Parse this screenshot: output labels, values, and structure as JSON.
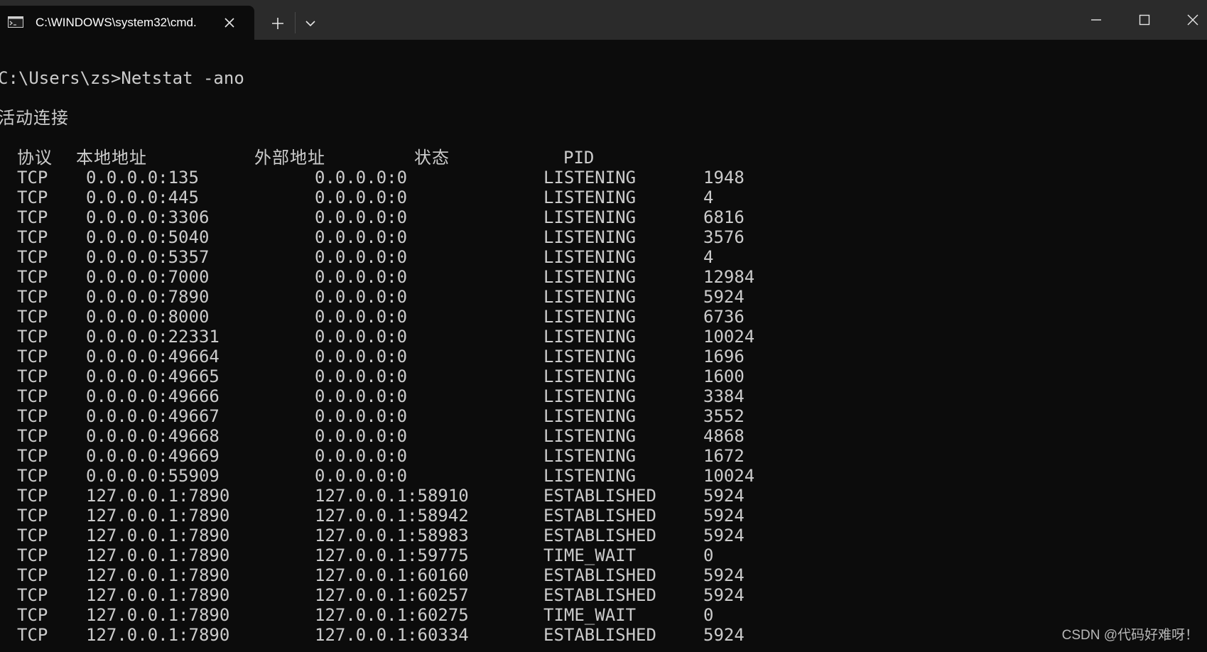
{
  "window": {
    "tab_title": "C:\\WINDOWS\\system32\\cmd.",
    "icons": {
      "tab": "terminal-icon",
      "close": "close-icon",
      "new_tab": "plus-icon",
      "dropdown": "chevron-down-icon",
      "minimize": "minimize-icon",
      "maximize": "maximize-icon",
      "window_close": "close-icon"
    },
    "colors": {
      "titlebar": "#2b2b2b",
      "background": "#0c0c0c",
      "text": "#cccccc"
    }
  },
  "console": {
    "prompt": "C:\\Users\\zs>Netstat -ano",
    "heading": "活动连接",
    "headers": {
      "proto": "协议",
      "local": "本地地址",
      "foreign": "外部地址",
      "state": "状态",
      "pid": "PID"
    },
    "rows": [
      {
        "proto": "TCP",
        "local": "0.0.0.0:135",
        "foreign": "0.0.0.0:0",
        "state": "LISTENING",
        "pid": "1948"
      },
      {
        "proto": "TCP",
        "local": "0.0.0.0:445",
        "foreign": "0.0.0.0:0",
        "state": "LISTENING",
        "pid": "4"
      },
      {
        "proto": "TCP",
        "local": "0.0.0.0:3306",
        "foreign": "0.0.0.0:0",
        "state": "LISTENING",
        "pid": "6816"
      },
      {
        "proto": "TCP",
        "local": "0.0.0.0:5040",
        "foreign": "0.0.0.0:0",
        "state": "LISTENING",
        "pid": "3576"
      },
      {
        "proto": "TCP",
        "local": "0.0.0.0:5357",
        "foreign": "0.0.0.0:0",
        "state": "LISTENING",
        "pid": "4"
      },
      {
        "proto": "TCP",
        "local": "0.0.0.0:7000",
        "foreign": "0.0.0.0:0",
        "state": "LISTENING",
        "pid": "12984"
      },
      {
        "proto": "TCP",
        "local": "0.0.0.0:7890",
        "foreign": "0.0.0.0:0",
        "state": "LISTENING",
        "pid": "5924"
      },
      {
        "proto": "TCP",
        "local": "0.0.0.0:8000",
        "foreign": "0.0.0.0:0",
        "state": "LISTENING",
        "pid": "6736"
      },
      {
        "proto": "TCP",
        "local": "0.0.0.0:22331",
        "foreign": "0.0.0.0:0",
        "state": "LISTENING",
        "pid": "10024"
      },
      {
        "proto": "TCP",
        "local": "0.0.0.0:49664",
        "foreign": "0.0.0.0:0",
        "state": "LISTENING",
        "pid": "1696"
      },
      {
        "proto": "TCP",
        "local": "0.0.0.0:49665",
        "foreign": "0.0.0.0:0",
        "state": "LISTENING",
        "pid": "1600"
      },
      {
        "proto": "TCP",
        "local": "0.0.0.0:49666",
        "foreign": "0.0.0.0:0",
        "state": "LISTENING",
        "pid": "3384"
      },
      {
        "proto": "TCP",
        "local": "0.0.0.0:49667",
        "foreign": "0.0.0.0:0",
        "state": "LISTENING",
        "pid": "3552"
      },
      {
        "proto": "TCP",
        "local": "0.0.0.0:49668",
        "foreign": "0.0.0.0:0",
        "state": "LISTENING",
        "pid": "4868"
      },
      {
        "proto": "TCP",
        "local": "0.0.0.0:49669",
        "foreign": "0.0.0.0:0",
        "state": "LISTENING",
        "pid": "1672"
      },
      {
        "proto": "TCP",
        "local": "0.0.0.0:55909",
        "foreign": "0.0.0.0:0",
        "state": "LISTENING",
        "pid": "10024"
      },
      {
        "proto": "TCP",
        "local": "127.0.0.1:7890",
        "foreign": "127.0.0.1:58910",
        "state": "ESTABLISHED",
        "pid": "5924"
      },
      {
        "proto": "TCP",
        "local": "127.0.0.1:7890",
        "foreign": "127.0.0.1:58942",
        "state": "ESTABLISHED",
        "pid": "5924"
      },
      {
        "proto": "TCP",
        "local": "127.0.0.1:7890",
        "foreign": "127.0.0.1:58983",
        "state": "ESTABLISHED",
        "pid": "5924"
      },
      {
        "proto": "TCP",
        "local": "127.0.0.1:7890",
        "foreign": "127.0.0.1:59775",
        "state": "TIME_WAIT",
        "pid": "0"
      },
      {
        "proto": "TCP",
        "local": "127.0.0.1:7890",
        "foreign": "127.0.0.1:60160",
        "state": "ESTABLISHED",
        "pid": "5924"
      },
      {
        "proto": "TCP",
        "local": "127.0.0.1:7890",
        "foreign": "127.0.0.1:60257",
        "state": "ESTABLISHED",
        "pid": "5924"
      },
      {
        "proto": "TCP",
        "local": "127.0.0.1:7890",
        "foreign": "127.0.0.1:60275",
        "state": "TIME_WAIT",
        "pid": "0"
      },
      {
        "proto": "TCP",
        "local": "127.0.0.1:7890",
        "foreign": "127.0.0.1:60334",
        "state": "ESTABLISHED",
        "pid": "5924"
      }
    ]
  },
  "watermark": "CSDN @代码好难呀！"
}
